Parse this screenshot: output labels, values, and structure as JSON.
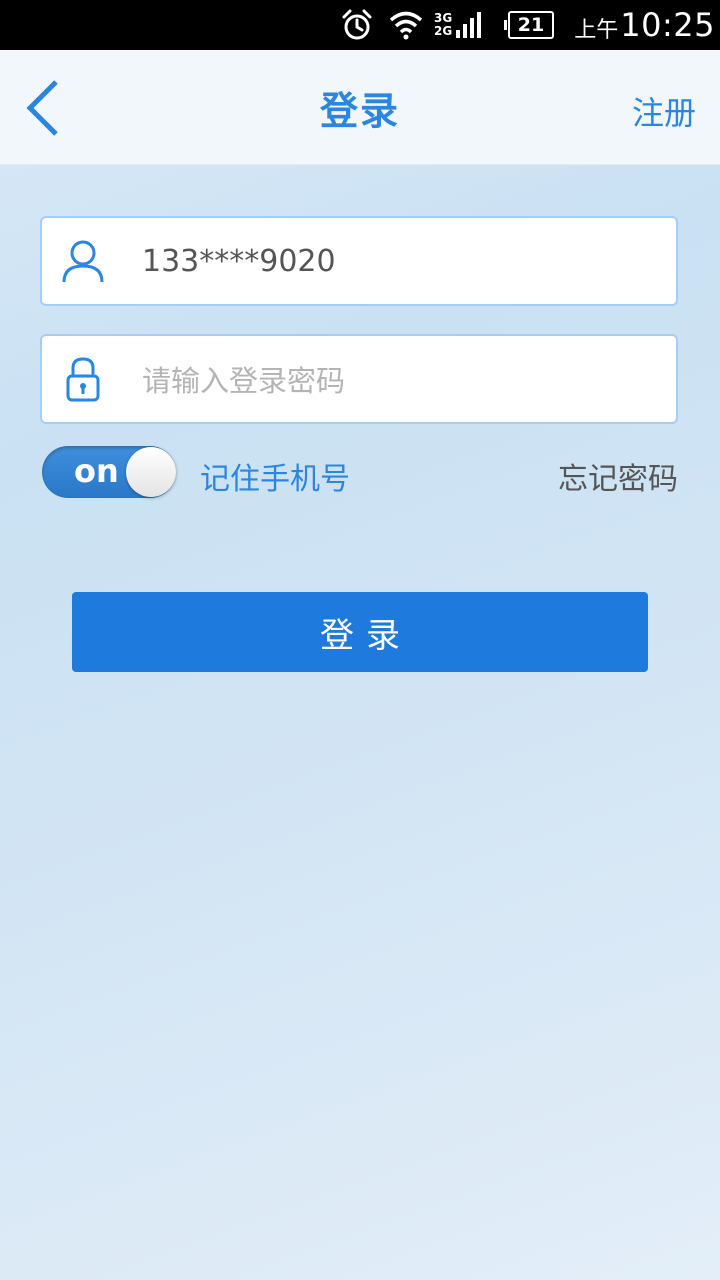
{
  "status_bar": {
    "net_top": "3G",
    "net_bottom": "2G",
    "battery": "21",
    "ampm": "上午",
    "time": "10:25"
  },
  "header": {
    "title": "登录",
    "register": "注册"
  },
  "form": {
    "phone_value": "133****9020",
    "password_placeholder": "请输入登录密码",
    "toggle_label": "on",
    "remember_label": "记住手机号",
    "forgot_label": "忘记密码",
    "login_button": "登录"
  },
  "colors": {
    "accent": "#2a86e0",
    "button": "#1f7ade"
  }
}
